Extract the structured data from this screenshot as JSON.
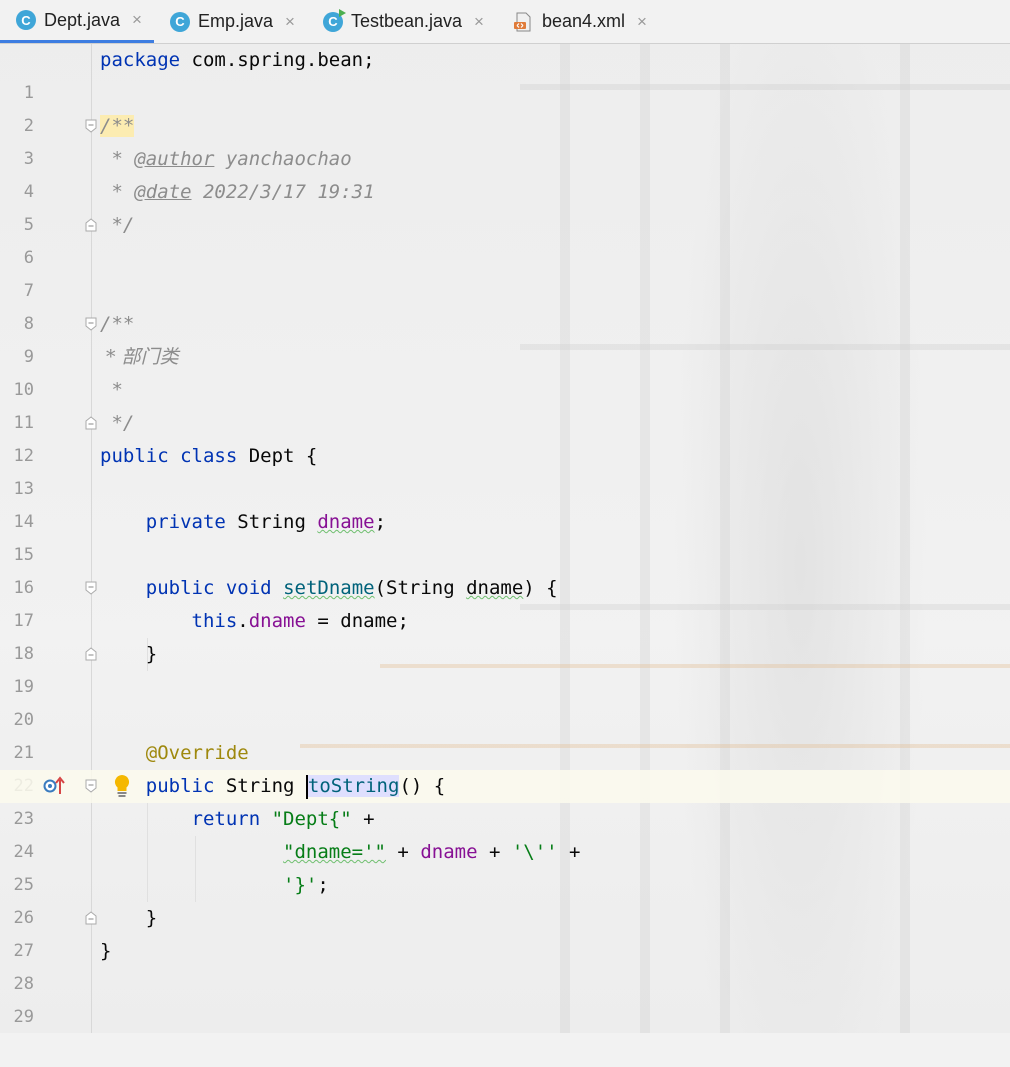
{
  "tabs": [
    {
      "label": "Dept.java",
      "icon": "class-icon",
      "active": true
    },
    {
      "label": "Emp.java",
      "icon": "class-icon",
      "active": false
    },
    {
      "label": "Testbean.java",
      "icon": "runnable-class-icon",
      "active": false
    },
    {
      "label": "bean4.xml",
      "icon": "xml-icon",
      "active": false
    }
  ],
  "close_glyph": "×",
  "line_numbers": [
    "1",
    "2",
    "3",
    "4",
    "5",
    "6",
    "7",
    "8",
    "9",
    "10",
    "11",
    "12",
    "13",
    "14",
    "15",
    "16",
    "17",
    "18",
    "19",
    "20",
    "21",
    "22",
    "23",
    "24",
    "25",
    "26",
    "27",
    "28",
    "29"
  ],
  "code": {
    "l1": {
      "kw": "package",
      "rest": " com.spring.bean;"
    },
    "l3": {
      "text": "/**"
    },
    "l4": {
      "pre": " * ",
      "tag": "@author",
      "post": " yanchaochao"
    },
    "l5": {
      "pre": " * ",
      "tag": "@date",
      "post": " 2022/3/17 19:31"
    },
    "l6": {
      "text": " */"
    },
    "l9": {
      "text": "/**"
    },
    "l10": {
      "text": " * 部门类"
    },
    "l11": {
      "text": " *"
    },
    "l12": {
      "text": " */"
    },
    "l13": {
      "kw": "public class",
      "rest": " Dept {"
    },
    "l15": {
      "indent": "    ",
      "kw": "private",
      "type": " String ",
      "field": "dname",
      "end": ";"
    },
    "l17": {
      "indent": "    ",
      "kw": "public void",
      "sp": " ",
      "method": "setDname",
      "open": "(String ",
      "param": "dname",
      "close": ") {"
    },
    "l18": {
      "indent": "        ",
      "kw": "this",
      "dot": ".",
      "field": "dname",
      "rest": " = dname;"
    },
    "l19": {
      "text": "    }"
    },
    "l22": {
      "indent": "    ",
      "annotation": "@Override"
    },
    "l23": {
      "indent": "    ",
      "kw": "public",
      "type": " String ",
      "method": "toString",
      "rest": "() {"
    },
    "l24": {
      "indent": "        ",
      "kw": "return",
      "sp": " ",
      "str": "\"Dept{\"",
      "rest": " +"
    },
    "l25": {
      "indent": "                ",
      "str1": "\"dname='\"",
      "mid1": " + ",
      "field": "dname",
      "mid2": " + ",
      "str2": "'\\''",
      "rest": " +"
    },
    "l26": {
      "indent": "                ",
      "str": "'}'",
      "rest": ";"
    },
    "l27": {
      "text": "    }"
    },
    "l28": {
      "text": "}"
    }
  }
}
